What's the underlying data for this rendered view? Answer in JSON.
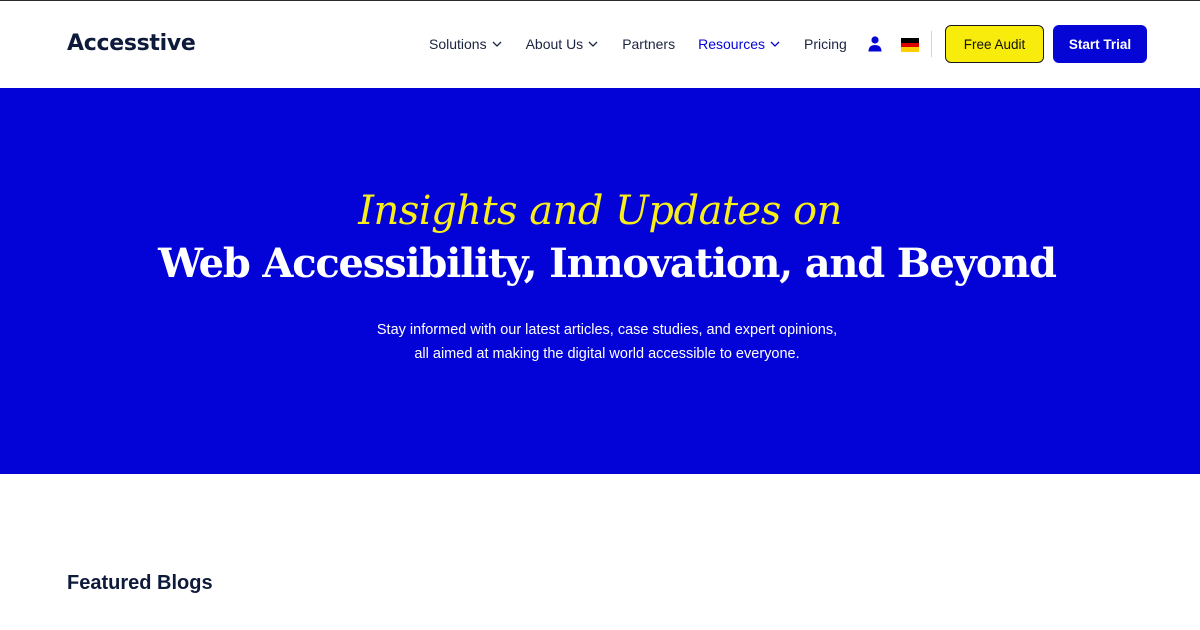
{
  "brand": {
    "name": "Accesstive"
  },
  "nav": {
    "items": [
      {
        "label": "Solutions",
        "has_dropdown": true,
        "active": false
      },
      {
        "label": "About Us",
        "has_dropdown": true,
        "active": false
      },
      {
        "label": "Partners",
        "has_dropdown": false,
        "active": false
      },
      {
        "label": "Resources",
        "has_dropdown": true,
        "active": true
      },
      {
        "label": "Pricing",
        "has_dropdown": false,
        "active": false
      }
    ],
    "user_icon": "user-icon",
    "language_flag": "german-flag-icon"
  },
  "buttons": {
    "free_audit": "Free Audit",
    "start_trial": "Start Trial"
  },
  "hero": {
    "kicker": "Insights and Updates on",
    "title": "Web Accessibility, Innovation, and Beyond",
    "subtitle_line1": "Stay informed with our latest articles, case studies, and expert opinions,",
    "subtitle_line2": "all aimed at making the digital world accessible to everyone."
  },
  "featured": {
    "title": "Featured Blogs"
  },
  "colors": {
    "brand_blue": "#0303d8",
    "accent_yellow": "#f7ee1a",
    "text_dark": "#0e1a3a"
  }
}
